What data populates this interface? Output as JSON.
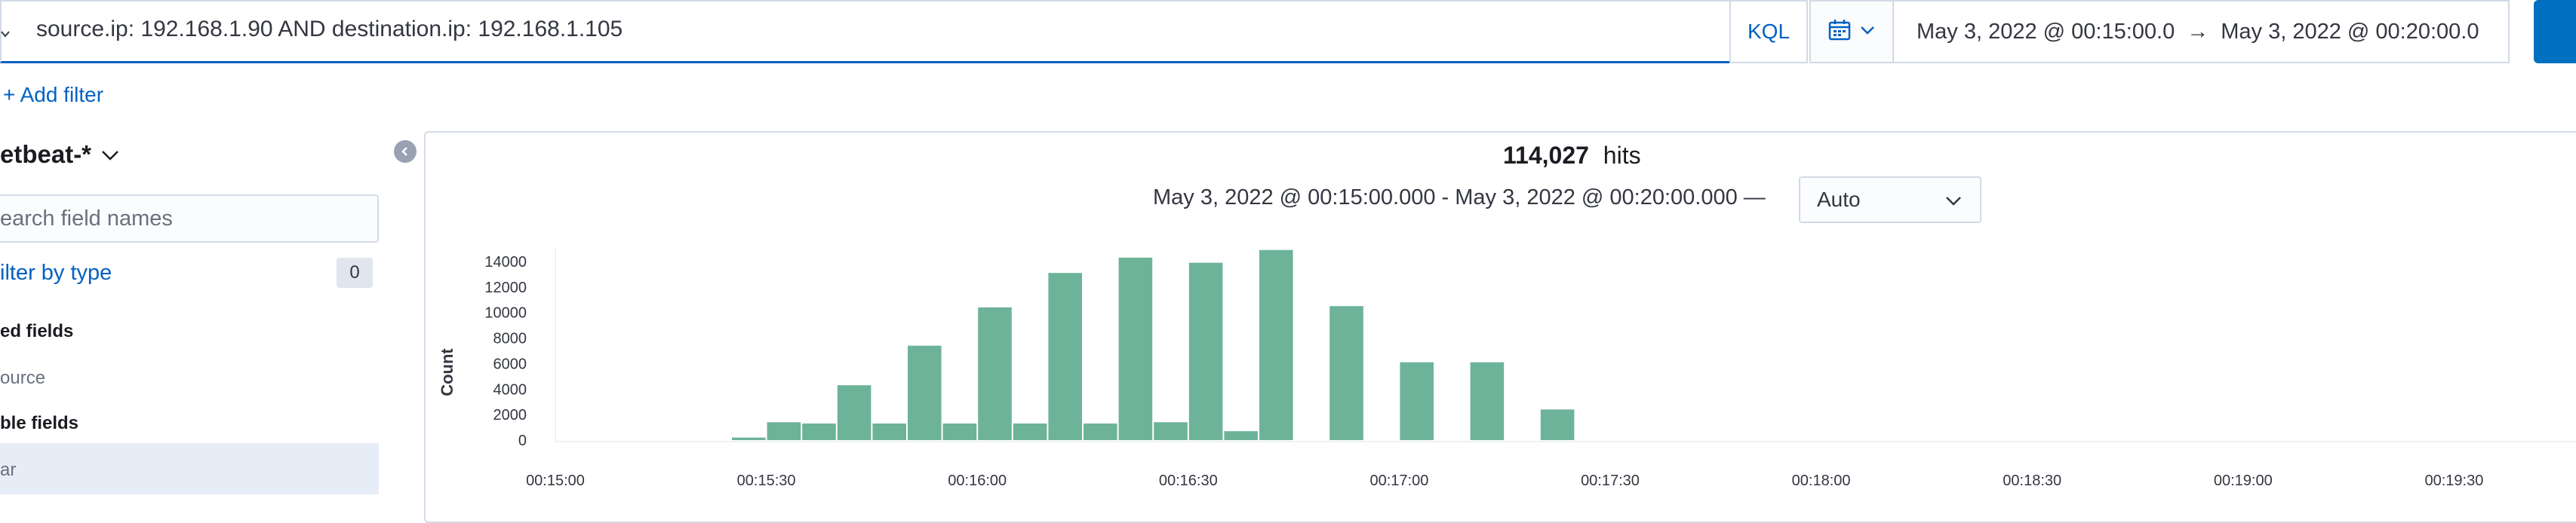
{
  "query_bar": {
    "query": "source.ip: 192.168.1.90 AND destination.ip: 192.168.1.105",
    "language_label": "KQL"
  },
  "date_picker": {
    "start": "May 3, 2022 @ 00:15:00.0",
    "arrow": "→",
    "end": "May 3, 2022 @ 00:20:00.0"
  },
  "filters": {
    "add_label": "+ Add filter"
  },
  "sidebar": {
    "index_pattern": "etbeat-*",
    "search_placeholder": "earch field names",
    "filter_by_type": "ilter by type",
    "filter_count": "0",
    "selected_heading": "ed fields",
    "selected_fields": [
      "ource"
    ],
    "available_heading": "ble fields",
    "available_fields": [
      "ar"
    ]
  },
  "results": {
    "hit_count": "114,027",
    "hits_label": "hits",
    "time_range": "May 3, 2022 @ 00:15:00.000 - May 3, 2022 @ 00:20:00.000 —",
    "interval": "Auto"
  },
  "colors": {
    "accent": "#0061c2",
    "bar": "#6db39a",
    "border": "#d3dae6"
  },
  "chart_data": {
    "type": "bar",
    "ylabel": "Count",
    "xlabel": "",
    "ylim": [
      0,
      15000
    ],
    "yticks": [
      0,
      2000,
      4000,
      6000,
      8000,
      10000,
      12000,
      14000
    ],
    "xticks": [
      "00:15:00",
      "00:15:30",
      "00:16:00",
      "00:16:30",
      "00:17:00",
      "00:17:30",
      "00:18:00",
      "00:18:30",
      "00:19:00",
      "00:19:30"
    ],
    "grid": false,
    "bucket_seconds": 5,
    "bars": [
      {
        "t": "00:15:25",
        "value": 200
      },
      {
        "t": "00:15:30",
        "value": 1400
      },
      {
        "t": "00:15:35",
        "value": 1300
      },
      {
        "t": "00:15:40",
        "value": 4300
      },
      {
        "t": "00:15:45",
        "value": 1300
      },
      {
        "t": "00:15:50",
        "value": 7400
      },
      {
        "t": "00:15:55",
        "value": 1300
      },
      {
        "t": "00:16:00",
        "value": 10400
      },
      {
        "t": "00:16:05",
        "value": 1300
      },
      {
        "t": "00:16:10",
        "value": 13100
      },
      {
        "t": "00:16:15",
        "value": 1300
      },
      {
        "t": "00:16:20",
        "value": 14300
      },
      {
        "t": "00:16:25",
        "value": 1400
      },
      {
        "t": "00:16:30",
        "value": 13900
      },
      {
        "t": "00:16:35",
        "value": 700
      },
      {
        "t": "00:16:40",
        "value": 14900
      },
      {
        "t": "00:16:50",
        "value": 10500
      },
      {
        "t": "00:17:00",
        "value": 6100
      },
      {
        "t": "00:17:10",
        "value": 6100
      },
      {
        "t": "00:17:20",
        "value": 2400
      }
    ]
  }
}
